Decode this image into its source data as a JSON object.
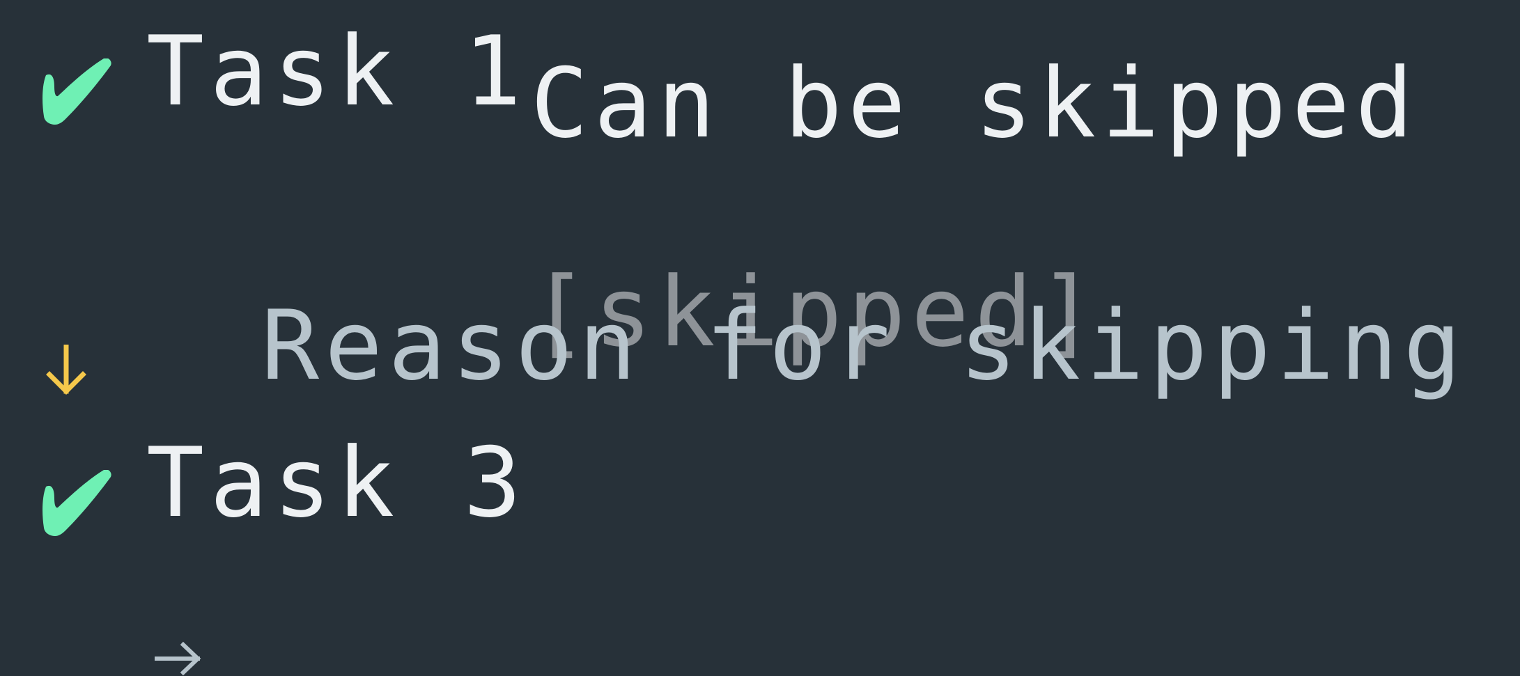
{
  "terminal": {
    "background_color": "#273139",
    "lines": [
      {
        "status": "completed",
        "icon": "check-icon",
        "icon_color": "#6ff0b4",
        "label": "Task 1"
      },
      {
        "status": "skipped",
        "icon": "arrow-down-icon",
        "icon_color": "#f5c84b",
        "label": "Can be skipped",
        "status_tag": "[skipped]",
        "status_tag_color": "#8e9398"
      },
      {
        "status": "reason",
        "icon": "arrow-right-icon",
        "icon_color": "#b7c4cc",
        "label": "Reason for skipping"
      },
      {
        "status": "completed",
        "icon": "check-icon",
        "icon_color": "#6ff0b4",
        "label": "Task 3"
      }
    ]
  }
}
